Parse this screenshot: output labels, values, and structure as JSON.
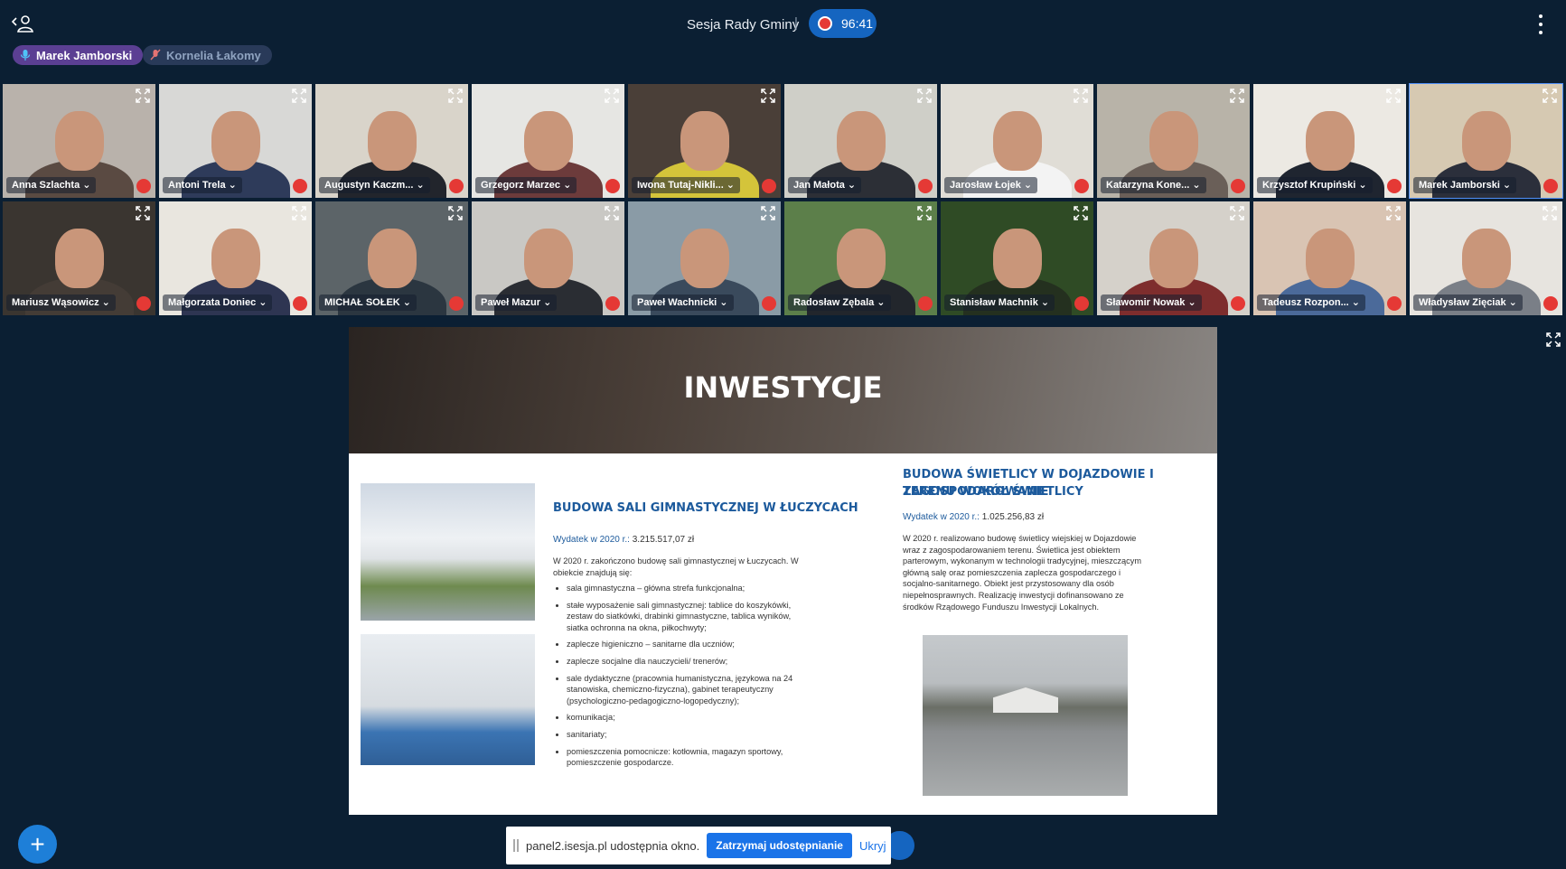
{
  "header": {
    "title": "Sesja Rady Gminy",
    "separator": "|",
    "timer": "96:41"
  },
  "speakers": [
    {
      "name": "Marek Jamborski",
      "state": "speaking"
    },
    {
      "name": "Kornelia Łakomy",
      "state": "muted"
    }
  ],
  "participants": [
    {
      "name": "Anna Szlachta",
      "bg": "#b9b2ab",
      "shirt": "#5a4a42"
    },
    {
      "name": "Antoni Trela",
      "bg": "#d8d8d6",
      "shirt": "#2e3b5a"
    },
    {
      "name": "Augustyn Kaczm...",
      "bg": "#d9d4ca",
      "shirt": "#22252c"
    },
    {
      "name": "Grzegorz Marzec",
      "bg": "#e6e6e3",
      "shirt": "#6c3b3b"
    },
    {
      "name": "Iwona Tutaj-Nikli...",
      "bg": "#4a3f38",
      "shirt": "#d4c43a"
    },
    {
      "name": "Jan Małota",
      "bg": "#cfcfc8",
      "shirt": "#2c2f36"
    },
    {
      "name": "Jarosław Łojek",
      "bg": "#e0ddd6",
      "shirt": "#f3f3f3"
    },
    {
      "name": "Katarzyna Kone...",
      "bg": "#b8b3a8",
      "shirt": "#6a5f58"
    },
    {
      "name": "Krzysztof Krupiński",
      "bg": "#ece9e3",
      "shirt": "#1f2530"
    },
    {
      "name": "Marek Jamborski",
      "bg": "#d6c9b2",
      "shirt": "#2b2f3b",
      "active": true
    },
    {
      "name": "Mariusz Wąsowicz",
      "bg": "#3a3530",
      "shirt": "#443c36"
    },
    {
      "name": "Małgorzata Doniec",
      "bg": "#e9e6df",
      "shirt": "#2e3552"
    },
    {
      "name": "MICHAŁ SOŁEK",
      "bg": "#5c6468",
      "shirt": "#2b3640"
    },
    {
      "name": "Paweł Mazur",
      "bg": "#c9c8c4",
      "shirt": "#2a2d33"
    },
    {
      "name": "Paweł Wachnicki",
      "bg": "#8a9ba6",
      "shirt": "#3a4a5c"
    },
    {
      "name": "Radosław Zębala",
      "bg": "#5c7f4a",
      "shirt": "#22262c"
    },
    {
      "name": "Stanisław Machnik",
      "bg": "#2f4b25",
      "shirt": "#24301f"
    },
    {
      "name": "Sławomir Nowak",
      "bg": "#d5d1ca",
      "shirt": "#7e2d2d"
    },
    {
      "name": "Tadeusz Rozpon...",
      "bg": "#d9c4b3",
      "shirt": "#4b6a9a"
    },
    {
      "name": "Władysław Zięciak",
      "bg": "#e7e4df",
      "shirt": "#7a7f87"
    }
  ],
  "shared": {
    "heading": "INWESTYCJE",
    "section1": {
      "title": "BUDOWA SALI GIMNASTYCZNEJ W ŁUCZYCACH",
      "expense_label": "Wydatek w 2020 r.:",
      "expense_value": "3.215.517,07 zł",
      "intro": "W 2020 r. zakończono budowę sali gimnastycznej w Łuczycach. W obiekcie znajdują się:",
      "bullets": [
        "sala gimnastyczna – główna strefa funkcjonalna;",
        "stałe wyposażenie sali gimnastycznej: tablice do koszykówki, zestaw do siatkówki, drabinki gimnastyczne, tablica wyników, siatka ochronna na okna, piłkochwyty;",
        "zaplecze higieniczno – sanitarne dla uczniów;",
        "zaplecze socjalne dla nauczycieli/ trenerów;",
        "sale dydaktyczne (pracownia humanistyczna, językowa na 24 stanowiska, chemiczno-fizyczna), gabinet terapeutyczny (psychologiczno-pedagogiczno-logopedyczny);",
        "komunikacja;",
        "sanitariaty;",
        "pomieszczenia pomocnicze: kotłownia, magazyn sportowy, pomieszczenie gospodarcze."
      ]
    },
    "section2": {
      "title_line1": "BUDOWA ŚWIETLICY W DOJAZDOWIE I ZAGOSPODAROWANIE",
      "title_line2": "TERENU WOKÓŁ ŚWIETLICY",
      "expense_label": "Wydatek w 2020 r.:",
      "expense_value": "1.025.256,83 zł",
      "text": "W 2020 r. realizowano budowę świetlicy wiejskiej w Dojazdowie wraz z zagospodarowaniem terenu. Świetlica jest obiektem parterowym, wykonanym w technologii tradycyjnej, mieszczącym główną salę oraz pomieszczenia zaplecza gospodarczego i socjalno-sanitarnego. Obiekt jest przystosowany dla osób niepełnosprawnych. Realizację inwestycji dofinansowano ze środków Rządowego Funduszu Inwestycji Lokalnych."
    }
  },
  "sharebar": {
    "text": "panel2.isesja.pl udostępnia okno.",
    "stop_label": "Zatrzymaj udostępnianie",
    "hide_label": "Ukryj"
  },
  "fab_label": "+"
}
